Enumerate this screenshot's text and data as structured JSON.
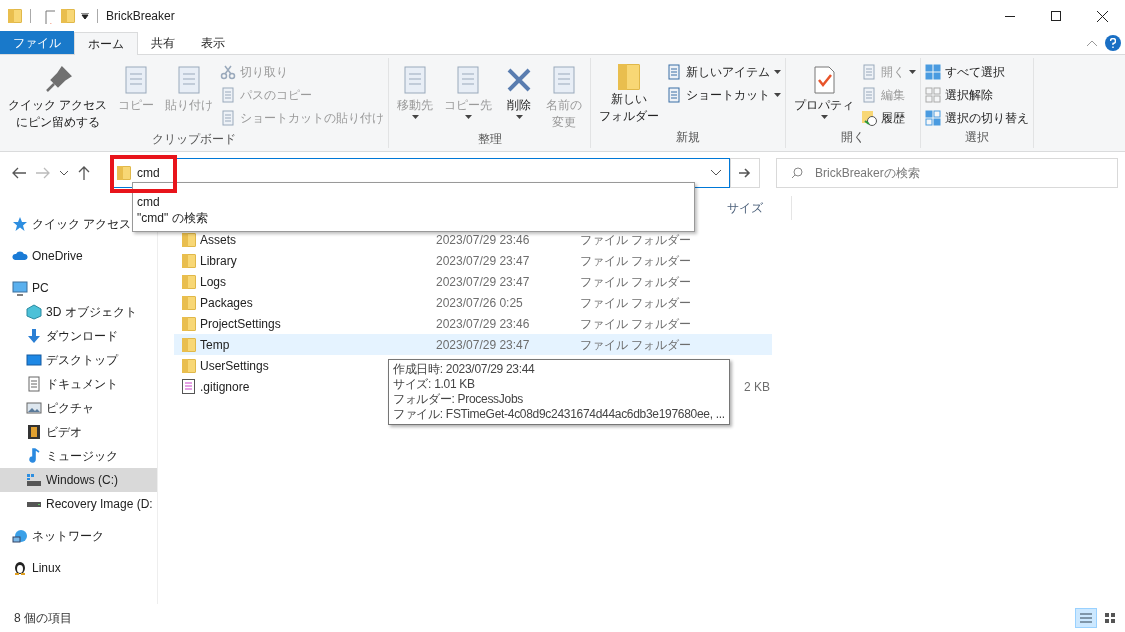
{
  "window": {
    "title": "BrickBreaker"
  },
  "ribbon_tabs": [
    {
      "label": "ファイル",
      "kind": "file",
      "selected": false
    },
    {
      "label": "ホーム",
      "kind": "tab",
      "selected": true
    },
    {
      "label": "共有",
      "kind": "tab",
      "selected": false
    },
    {
      "label": "表示",
      "kind": "tab",
      "selected": false
    }
  ],
  "ribbon_groups": [
    {
      "label": "クリップボード",
      "items": [
        {
          "kind": "large",
          "lines": [
            "クイック アクセス",
            "にピン留めする"
          ],
          "disabled": false
        },
        {
          "kind": "large",
          "lines": [
            "コピー"
          ],
          "disabled": true
        },
        {
          "kind": "large",
          "lines": [
            "貼り付け"
          ],
          "disabled": true
        },
        {
          "kind": "stack",
          "items": [
            {
              "label": "切り取り",
              "disabled": true
            },
            {
              "label": "パスのコピー",
              "disabled": true
            },
            {
              "label": "ショートカットの貼り付け",
              "disabled": true
            }
          ]
        }
      ]
    },
    {
      "label": "整理",
      "items": [
        {
          "kind": "large",
          "lines": [
            "移動先"
          ],
          "disabled": true,
          "caret": true
        },
        {
          "kind": "large",
          "lines": [
            "コピー先"
          ],
          "disabled": true,
          "caret": true
        },
        {
          "kind": "large",
          "lines": [
            "削除"
          ],
          "disabled": false,
          "caret": true
        },
        {
          "kind": "large",
          "lines": [
            "名前の",
            "変更"
          ],
          "disabled": true
        }
      ]
    },
    {
      "label": "新規",
      "items": [
        {
          "kind": "large",
          "lines": [
            "新しい",
            "フォルダー"
          ],
          "disabled": false
        },
        {
          "kind": "stack",
          "items": [
            {
              "label": "新しいアイテム",
              "disabled": false,
              "caret": true
            },
            {
              "label": "ショートカット",
              "disabled": false,
              "caret": true
            }
          ]
        }
      ]
    },
    {
      "label": "開く",
      "items": [
        {
          "kind": "large",
          "lines": [
            "プロパティ"
          ],
          "disabled": false,
          "caret": true
        },
        {
          "kind": "stack",
          "items": [
            {
              "label": "開く",
              "disabled": true,
              "caret": true
            },
            {
              "label": "編集",
              "disabled": true
            },
            {
              "label": "履歴",
              "disabled": false
            }
          ]
        }
      ]
    },
    {
      "label": "選択",
      "items": [
        {
          "kind": "stack",
          "items": [
            {
              "label": "すべて選択",
              "disabled": false
            },
            {
              "label": "選択解除",
              "disabled": false
            },
            {
              "label": "選択の切り替え",
              "disabled": false
            }
          ]
        }
      ]
    }
  ],
  "address_bar": {
    "value": "cmd",
    "suggestions": [
      "cmd",
      "\"cmd\" の検索"
    ]
  },
  "search": {
    "placeholder": "BrickBreakerの検索"
  },
  "columns": [
    {
      "label": "サイズ"
    }
  ],
  "sidebar": {
    "items": [
      {
        "label": "クイック アクセス",
        "selected": false
      },
      {
        "label": "OneDrive",
        "selected": false
      },
      {
        "label": "PC",
        "selected": false,
        "children": [
          {
            "label": "3D オブジェクト",
            "selected": false
          },
          {
            "label": "ダウンロード",
            "selected": false
          },
          {
            "label": "デスクトップ",
            "selected": false
          },
          {
            "label": "ドキュメント",
            "selected": false
          },
          {
            "label": "ピクチャ",
            "selected": false
          },
          {
            "label": "ビデオ",
            "selected": false
          },
          {
            "label": "ミュージック",
            "selected": false
          },
          {
            "label": "Windows (C:)",
            "selected": true
          },
          {
            "label": "Recovery Image (D:",
            "selected": false
          }
        ]
      },
      {
        "label": "ネットワーク",
        "selected": false
      },
      {
        "label": "Linux",
        "selected": false
      }
    ]
  },
  "files": [
    {
      "name": "Assets",
      "kind": "folder",
      "date": "2023/07/29 23:46",
      "type": "ファイル フォルダー",
      "highlighted": false
    },
    {
      "name": "Library",
      "kind": "folder",
      "date": "2023/07/29 23:47",
      "type": "ファイル フォルダー",
      "highlighted": false
    },
    {
      "name": "Logs",
      "kind": "folder",
      "date": "2023/07/29 23:47",
      "type": "ファイル フォルダー",
      "highlighted": false
    },
    {
      "name": "Packages",
      "kind": "folder",
      "date": "2023/07/26 0:25",
      "type": "ファイル フォルダー",
      "highlighted": false
    },
    {
      "name": "ProjectSettings",
      "kind": "folder",
      "date": "2023/07/29 23:46",
      "type": "ファイル フォルダー",
      "highlighted": false
    },
    {
      "name": "Temp",
      "kind": "folder",
      "date": "2023/07/29 23:47",
      "type": "ファイル フォルダー",
      "highlighted": true
    },
    {
      "name": "UserSettings",
      "kind": "folder",
      "highlighted": false
    },
    {
      "name": ".gitignore",
      "kind": "file",
      "size": "2 KB",
      "highlighted": false
    }
  ],
  "tooltip": {
    "lines": [
      "作成日時: 2023/07/29 23:44",
      "サイズ: 1.01 KB",
      "フォルダー: ProcessJobs",
      "ファイル: FSTimeGet-4c08d9c2431674d44ac6db3e197680ee, ..."
    ]
  },
  "status_bar": {
    "item_count": "8 個の項目"
  }
}
